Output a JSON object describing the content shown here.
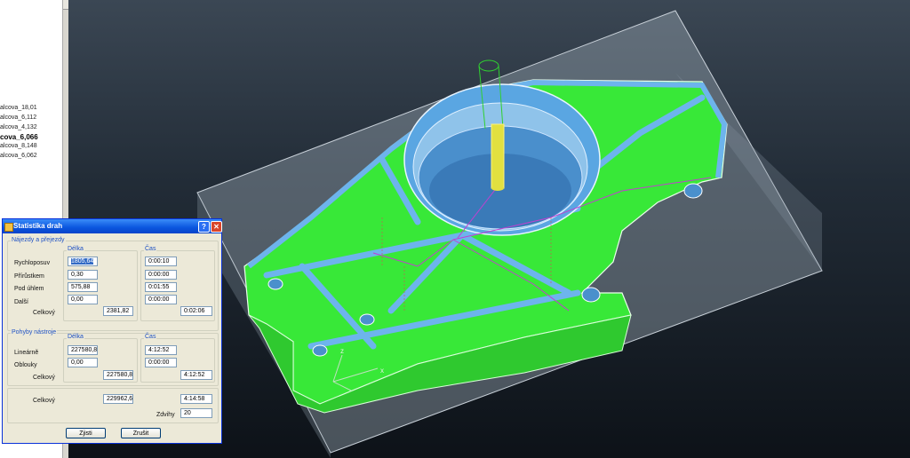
{
  "tree": {
    "items": [
      {
        "label": "alcova_18,01",
        "bold": false
      },
      {
        "label": "alcova_6,112",
        "bold": false
      },
      {
        "label": "alcova_4,132",
        "bold": false
      },
      {
        "label": "cova_6,066",
        "bold": true
      },
      {
        "label": "alcova_8,148",
        "bold": false
      },
      {
        "label": "alcova_6,062",
        "bold": false
      }
    ]
  },
  "dialog": {
    "title": "Statistika drah",
    "rapid_group": {
      "title": "Nájezdy a přejezdy",
      "length_header": "Délka",
      "time_header": "Čas",
      "rows": [
        {
          "label": "Rychloposuv",
          "length": "1805,64",
          "time": "0:00:10"
        },
        {
          "label": "Přírůstkem",
          "length": "0,30",
          "time": "0:00:00"
        },
        {
          "label": "Pod úhlem",
          "length": "575,88",
          "time": "0:01:55"
        },
        {
          "label": "Další",
          "length": "0,00",
          "time": "0:00:00"
        }
      ],
      "total_label": "Celkový",
      "total_length": "2381,82",
      "total_time": "0:02:06"
    },
    "tool_group": {
      "title": "Pohyby nástroje",
      "length_header": "Délka",
      "time_header": "Čas",
      "rows": [
        {
          "label": "Lineárně",
          "length": "227580,8",
          "time": "4:12:52"
        },
        {
          "label": "Oblouky",
          "length": "0,00",
          "time": "0:00:00"
        }
      ],
      "total_label": "Celkový",
      "total_length": "227580,8",
      "total_time": "4:12:52"
    },
    "grand_total_label": "Celkový",
    "grand_total_length": "229962,6",
    "grand_total_time": "4:14:58",
    "lifts_label": "Zdvihy",
    "lifts_value": "20",
    "detect_button": "Zjisti",
    "cancel_button": "Zrušit",
    "help_glyph": "?",
    "close_glyph": "✕"
  },
  "colors": {
    "part_green": "#3cf23a",
    "part_blue": "#5aa8e6",
    "stock": "#9aa6b4",
    "toolpath": "#c040d0",
    "tool": "#e0e040",
    "holder": "#30d030"
  }
}
